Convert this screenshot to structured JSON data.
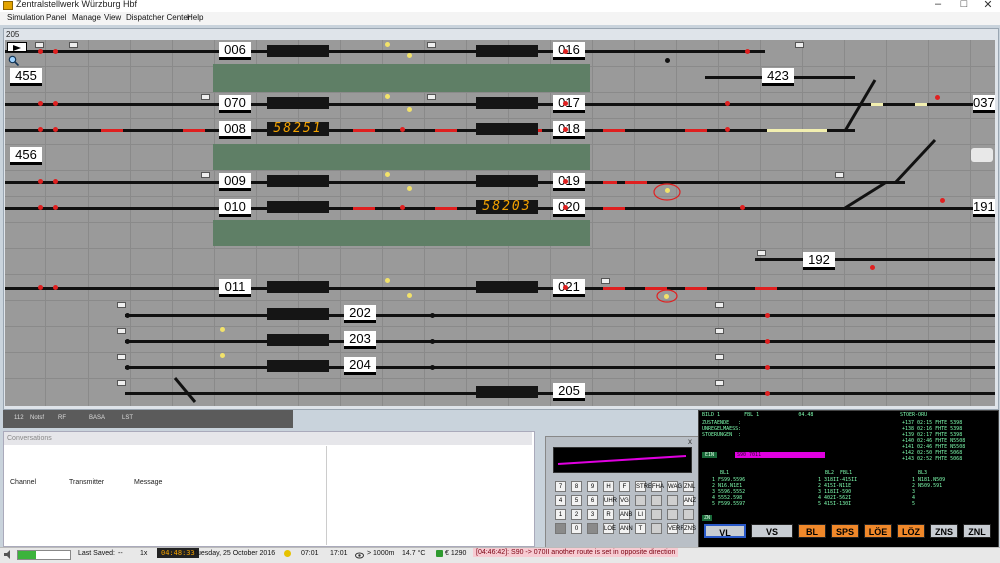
{
  "window": {
    "title": "Zentralstellwerk Würzburg Hbf",
    "minimize": "–",
    "maximize": "□",
    "close": "✕"
  },
  "menu": {
    "items": [
      "Simulation",
      "Panel",
      "Manage",
      "View",
      "Dispatcher Center",
      "Help"
    ]
  },
  "panel": {
    "id": "205",
    "track_labels": [
      "006",
      "016",
      "455",
      "423",
      "070",
      "017",
      "037",
      "008",
      "018",
      "456",
      "009",
      "019",
      "010",
      "020",
      "191",
      "192",
      "011",
      "021",
      "202",
      "203",
      "204",
      "205"
    ],
    "train_numbers": [
      "58251",
      "58203"
    ]
  },
  "tabs": [
    "112",
    "Notsf",
    "RF",
    "BASA",
    "LST"
  ],
  "conversations": {
    "title": "Conversations",
    "columns": [
      "Channel",
      "Transmitter",
      "Message"
    ]
  },
  "keypad": {
    "close": "x",
    "keys": [
      [
        "7",
        "8",
        "9",
        "H",
        "F",
        "STRE",
        "FHA",
        "WAG",
        "ZNL"
      ],
      [
        "4",
        "5",
        "6",
        "UHR",
        "VG",
        "",
        "",
        "",
        "ANZ"
      ],
      [
        "1",
        "2",
        "3",
        "R",
        "ANB",
        "LI",
        "",
        "",
        ""
      ],
      [
        "",
        "0",
        "",
        "LOE",
        "ANN",
        "T",
        "",
        "VERR",
        "ZNS"
      ]
    ]
  },
  "console": {
    "header": "BILD 1        FBL 1             04.48",
    "status_lines": [
      "ZUSTAENDE   :",
      "UNREGELMAESS:",
      "STOERUNGEN  :"
    ],
    "right_header": "STOER-ORU",
    "right_lines": [
      "+137 02:15 FHTE 5398",
      "+138 02:16 FHTE 5398",
      "+139 02:17 FHTE 5398",
      "+140 02:46 FHTE N5508",
      "+141 02:46 FHTE N5508",
      "+142 02:50 FHTE 5068",
      "+143 02:52 FHTE 5068"
    ],
    "ein_label": "EIN",
    "ein_value": "S90 7011",
    "col_headers": [
      "BL1",
      "BL2  FBL1",
      "BL3"
    ],
    "col1": [
      "1 FS99.5596",
      "2 N16.N1E1",
      "3 5596.5552",
      "4 5552.598",
      "5 F599.5597"
    ],
    "col2": [
      "1 318II-415II",
      "2 415I-N11E",
      "3 118II-590",
      "4 402I-562I",
      "5 415I-130I"
    ],
    "col3": [
      "1 N181.N509",
      "2 N509.591",
      "3",
      "4",
      "5"
    ],
    "zn_label": "ZN",
    "buttons": [
      "VL",
      "VS",
      "BL",
      "SPS",
      "LÖE",
      "LÖZ",
      "ZNS",
      "ZNL"
    ]
  },
  "statusbar": {
    "last_saved_label": "Last Saved:",
    "last_saved_value": "--",
    "speed": "1x",
    "clock": "04:48:33",
    "date": "Tuesday, 25 October 2016",
    "sunrise": "07:01",
    "sunset": "17:01",
    "visibility": "> 1000m",
    "temperature": "14.7 °C",
    "money": "€ 1290",
    "message": "[04:46:42]: S90 -> 070II another route is set in opposite direction"
  },
  "colors": {
    "accent_orange": "#f0882a",
    "red_route": "#e02020",
    "console_green": "#7fffb0",
    "magenta_route": "#e000e0"
  }
}
